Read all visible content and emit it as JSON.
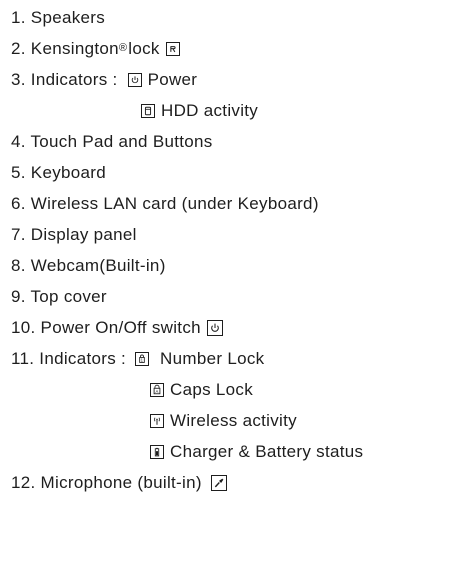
{
  "items": [
    {
      "label": "1. Speakers"
    },
    {
      "label": "2. Kensington",
      "sup": "®",
      "suffix": "lock",
      "icon": "kensington-lock-icon"
    },
    {
      "label": "3. Indicators :",
      "icon": "power-indicator-icon",
      "suffix": "Power"
    },
    {
      "icon": "hdd-activity-icon",
      "label": "HDD activity"
    },
    {
      "label": "4. Touch Pad and Buttons"
    },
    {
      "label": "5. Keyboard"
    },
    {
      "label": "6. Wireless LAN card (under Keyboard)"
    },
    {
      "label": "7. Display panel"
    },
    {
      "label": "8. Webcam(Built-in)"
    },
    {
      "label": "9. Top cover"
    },
    {
      "label": "10. Power On/Off switch",
      "icon": "power-switch-icon"
    },
    {
      "label": "11. Indicators :",
      "icon": "number-lock-icon",
      "suffix": "Number Lock"
    },
    {
      "icon": "caps-lock-icon",
      "label": "Caps Lock"
    },
    {
      "icon": "wireless-activity-icon",
      "label": "Wireless activity"
    },
    {
      "icon": "battery-status-icon",
      "label": "Charger & Battery status"
    },
    {
      "label": "12. Microphone (built-in)",
      "icon": "microphone-icon"
    }
  ],
  "colors": {
    "text": "#1e1e1e",
    "background": "#ffffff"
  }
}
